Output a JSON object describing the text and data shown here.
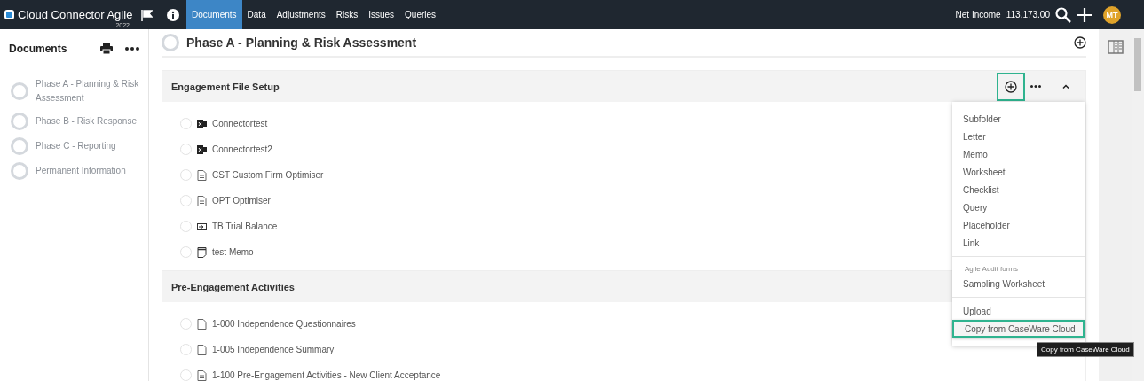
{
  "app": {
    "title": "Cloud Connector Agile",
    "year": "2022",
    "nav": [
      {
        "label": "Documents",
        "selected": true
      },
      {
        "label": "Data",
        "selected": false
      },
      {
        "label": "Adjustments",
        "selected": false
      },
      {
        "label": "Risks",
        "selected": false
      },
      {
        "label": "Issues",
        "selected": false
      },
      {
        "label": "Queries",
        "selected": false
      }
    ],
    "net_income_label": "Net Income",
    "net_income_value": "113,173.00",
    "avatar": "MT"
  },
  "sidebar": {
    "title": "Documents",
    "items": [
      {
        "label": "Phase A - Planning & Risk Assessment"
      },
      {
        "label": "Phase B - Risk Response"
      },
      {
        "label": "Phase C - Reporting"
      },
      {
        "label": "Permanent Information"
      }
    ]
  },
  "page_title": "Phase A - Planning & Risk Assessment",
  "sections": [
    {
      "title": "Engagement File Setup",
      "add_highlighted": true,
      "items": [
        {
          "kind": "excel",
          "label": "Connectortest"
        },
        {
          "kind": "excel",
          "label": "Connectortest2"
        },
        {
          "kind": "checklist",
          "label": "CST Custom Firm Optimiser"
        },
        {
          "kind": "checklist",
          "label": "OPT Optimiser"
        },
        {
          "kind": "balance",
          "label": "TB Trial Balance"
        },
        {
          "kind": "memo",
          "label": "test Memo"
        }
      ]
    },
    {
      "title": "Pre-Engagement Activities",
      "items": [
        {
          "kind": "document",
          "label": "1-000 Independence Questionnaires"
        },
        {
          "kind": "document",
          "label": "1-005 Independence Summary"
        },
        {
          "kind": "checklist",
          "label": "1-100 Pre-Engagement Activities - New Client Acceptance"
        }
      ]
    }
  ],
  "add_menu": {
    "groups": [
      {
        "items": [
          {
            "label": "Subfolder",
            "highlighted": false
          },
          {
            "label": "Letter",
            "highlighted": false
          },
          {
            "label": "Memo",
            "highlighted": false
          },
          {
            "label": "Worksheet",
            "highlighted": false
          },
          {
            "label": "Checklist",
            "highlighted": false
          },
          {
            "label": "Query",
            "highlighted": false
          },
          {
            "label": "Placeholder",
            "highlighted": false
          },
          {
            "label": "Link",
            "highlighted": false
          }
        ]
      },
      {
        "heading": "Agile Audit forms",
        "items": [
          {
            "label": "Sampling Worksheet",
            "highlighted": false
          }
        ]
      },
      {
        "items": [
          {
            "label": "Upload",
            "highlighted": false
          },
          {
            "label": "Copy from CaseWare Cloud",
            "highlighted": true
          }
        ]
      }
    ],
    "tooltip": "Copy from CaseWare Cloud"
  }
}
